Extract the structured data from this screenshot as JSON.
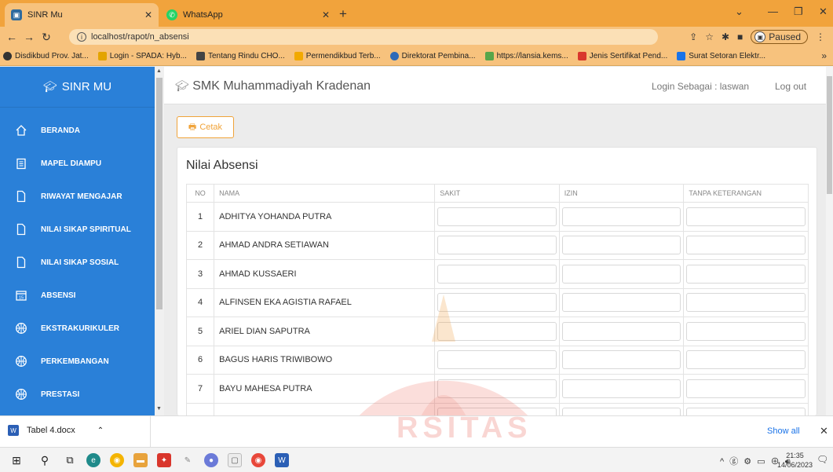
{
  "browser": {
    "tabs": [
      {
        "title": "SINR Mu",
        "active": true
      },
      {
        "title": "WhatsApp",
        "active": false
      }
    ],
    "url": "localhost/rapot/n_absensi",
    "profile_status": "Paused",
    "bookmarks": [
      {
        "label": "Disdikbud Prov. Jat...",
        "color": "#333333"
      },
      {
        "label": "Login - SPADA: Hyb...",
        "color": "#e3a400"
      },
      {
        "label": "Tentang Rindu CHO...",
        "color": "#444444"
      },
      {
        "label": "Permendikbud Terb...",
        "color": "#f2a900"
      },
      {
        "label": "Direktorat Pembina...",
        "color": "#2f6ab8"
      },
      {
        "label": "https://lansia.kems...",
        "color": "#57a64a"
      },
      {
        "label": "Jenis Sertifikat Pend...",
        "color": "#d9362c"
      },
      {
        "label": "Surat Setoran Elektr...",
        "color": "#1a73e8"
      }
    ]
  },
  "sidebar": {
    "brand": "SINR MU",
    "items": [
      {
        "label": "BERANDA",
        "icon": "home-icon"
      },
      {
        "label": "MAPEL DIAMPU",
        "icon": "clipboard-icon"
      },
      {
        "label": "RIWAYAT MENGAJAR",
        "icon": "document-icon"
      },
      {
        "label": "NILAI SIKAP SPIRITUAL",
        "icon": "document-icon"
      },
      {
        "label": "NILAI SIKAP SOSIAL",
        "icon": "document-icon"
      },
      {
        "label": "ABSENSI",
        "icon": "calendar-icon"
      },
      {
        "label": "EKSTRAKURIKULER",
        "icon": "basketball-icon"
      },
      {
        "label": "PERKEMBANGAN",
        "icon": "basketball-icon"
      },
      {
        "label": "PRESTASI",
        "icon": "basketball-icon"
      }
    ]
  },
  "header": {
    "school": "SMK Muhammadiyah Kradenan",
    "login_as": "Login Sebagai : laswan",
    "logout": "Log out"
  },
  "print_button": "Cetak",
  "card_title": "Nilai Absensi",
  "table": {
    "headers": [
      "NO",
      "NAMA",
      "SAKIT",
      "IZIN",
      "TANPA KETERANGAN"
    ],
    "rows": [
      {
        "no": "1",
        "nama": "ADHITYA YOHANDA PUTRA"
      },
      {
        "no": "2",
        "nama": "AHMAD ANDRA SETIAWAN"
      },
      {
        "no": "3",
        "nama": "AHMAD KUSSAERI"
      },
      {
        "no": "4",
        "nama": "ALFINSEN EKA AGISTIA RAFAEL"
      },
      {
        "no": "5",
        "nama": "ARIEL DIAN SAPUTRA"
      },
      {
        "no": "6",
        "nama": "BAGUS HARIS TRIWIBOWO"
      },
      {
        "no": "7",
        "nama": "BAYU MAHESA PUTRA"
      }
    ]
  },
  "download": {
    "file": "Tabel 4.docx",
    "show_all": "Show all"
  },
  "taskbar": {
    "time": "21:35",
    "date": "14/06/2023"
  },
  "watermark": {
    "text": "RSITAS"
  }
}
